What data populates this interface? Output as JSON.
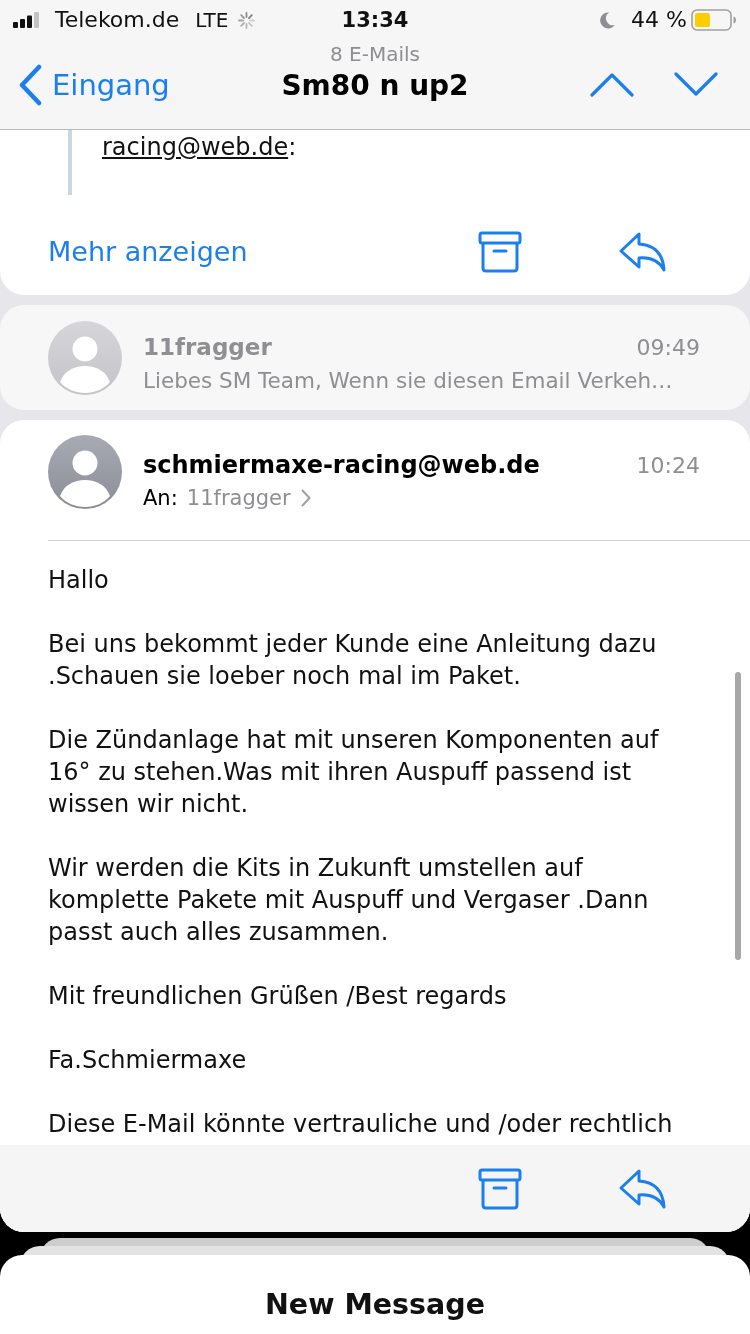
{
  "status_bar": {
    "carrier": "Telekom.de",
    "network": "LTE",
    "time": "13:34",
    "battery_percent": "44 %",
    "low_power": true
  },
  "nav": {
    "back_label": "Eingang",
    "subtitle": "8 E-Mails",
    "title": "Sm80 n up2"
  },
  "messages": [
    {
      "kind": "tail",
      "quote": {
        "link": "racing@web.de",
        "after": ":"
      },
      "more_label": "Mehr anzeigen"
    },
    {
      "kind": "collapsed",
      "sender": "11fragger",
      "time": "09:49",
      "preview": "Liebes SM Team, Wenn sie diesen Email Verkeh…"
    },
    {
      "kind": "expanded",
      "sender": "schmiermaxe-racing@web.de",
      "time": "10:24",
      "to_label": "An:",
      "to": "11fragger",
      "body": [
        "Hallo",
        "Bei uns bekommt jeder Kunde eine Anleitung dazu .Schauen sie loeber noch mal im Paket.",
        "Die Zündanlage hat mit unseren Komponenten auf 16° zu stehen.Was mit ihren Auspuff passend ist wissen wir nicht.",
        "Wir werden die Kits in Zukunft umstellen auf komplette Pakete mit Auspuff und Vergaser .Dann passt auch alles zusammen.",
        "Mit freundlichen Grüßen /Best regards",
        "Fa.Schmiermaxe",
        "Diese E-Mail könnte vertrauliche und /oder rechtlich"
      ]
    }
  ],
  "compose_sheet": {
    "title": "New Message"
  }
}
